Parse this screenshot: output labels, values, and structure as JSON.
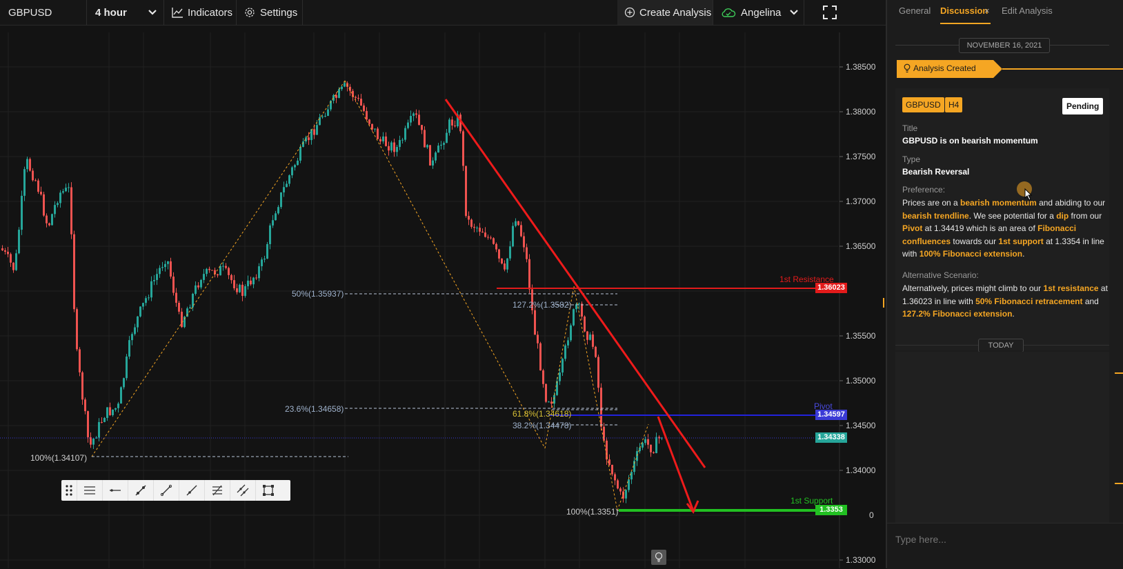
{
  "toolbar": {
    "symbol": "GBPUSD",
    "timeframe": "4 hour",
    "indicators_label": "Indicators",
    "settings_label": "Settings",
    "create_analysis_label": "Create Analysis",
    "user_name": "Angelina"
  },
  "right_panel": {
    "tabs": [
      {
        "label": "General"
      },
      {
        "label": "Discussion"
      },
      {
        "label": "Edit Analysis"
      }
    ],
    "tab_close": "×",
    "date_chip": "NOVEMBER 16, 2021",
    "analysis_created": "Analysis Created",
    "chips": [
      "GBPUSD",
      "H4"
    ],
    "status": "Pending",
    "title_label": "Title",
    "title_value": "GBPUSD is on bearish momentum",
    "type_label": "Type",
    "type_value": "Bearish Reversal",
    "preference_label": "Preference:",
    "preference": {
      "t1": "Prices are on a ",
      "h1": "bearish momentum",
      "t2": " and abiding to our ",
      "h2": "bearish trendline",
      "t3": ". We see potential for a ",
      "h3": "dip",
      "t4": " from our ",
      "h4": "Pivot",
      "t5": " at 1.34419 which is an area of ",
      "h5": "Fibonacci confluences",
      "t6": " towards our ",
      "h6": "1st support",
      "t7": " at 1.3354 in line with ",
      "h7": "100% Fibonacci extension",
      "t8": "."
    },
    "alternative_label": "Alternative Scenario:",
    "alternative": {
      "t1": "Alternatively, prices might climb to our ",
      "h1": "1st resistance",
      "t2": " at 1.36023 in line with ",
      "h2": "50% Fibonacci retracement",
      "t3": " and ",
      "h3": "127.2% Fibonacci extension",
      "t4": "."
    },
    "today_chip": "TODAY",
    "input_placeholder": "Type here..."
  },
  "price_axis": {
    "ticks": [
      "1.38500",
      "1.38000",
      "1.37500",
      "1.37000",
      "1.36500",
      "1.35500",
      "1.35000",
      "1.34500",
      "1.34000",
      "1.33000"
    ],
    "partial_tick": "0",
    "tags": [
      {
        "name": "resistance",
        "label": "1.36023",
        "color": "#e31b1b"
      },
      {
        "name": "pivot",
        "label": "1.34597",
        "color": "#3a3ad6"
      },
      {
        "name": "current",
        "label": "1.34338",
        "color": "#26a69a"
      },
      {
        "name": "support",
        "label": "1.3353",
        "color": "#22c022"
      }
    ]
  },
  "chart_labels": {
    "resistance": "1st Resistance",
    "pivot": "Pivot",
    "support": "1st Support",
    "fib_50": "50%(1.35937)",
    "fib_127": "127.2%(1.3582)",
    "fib_236": "23.6%(1.34658)",
    "fib_618": "61.8%(1.34618)",
    "fib_382": "38.2%(1.34478)",
    "fib_100_left": "100%(1.34107)",
    "fib_100_right": "100%(1.3351)"
  },
  "drawing_tools": [
    "drag-handle-icon",
    "horizontal-lines-icon",
    "horizontal-ray-icon",
    "trend-line-icon",
    "line-icon",
    "ray-icon",
    "fib-icon",
    "parallel-channel-icon",
    "rectangle-icon"
  ],
  "colors": {
    "accent": "#f5a623",
    "up": "#26a69a",
    "down": "#ef5350",
    "resistance": "#e31b1b",
    "support": "#22c022",
    "pivot": "#3a3ad6"
  }
}
